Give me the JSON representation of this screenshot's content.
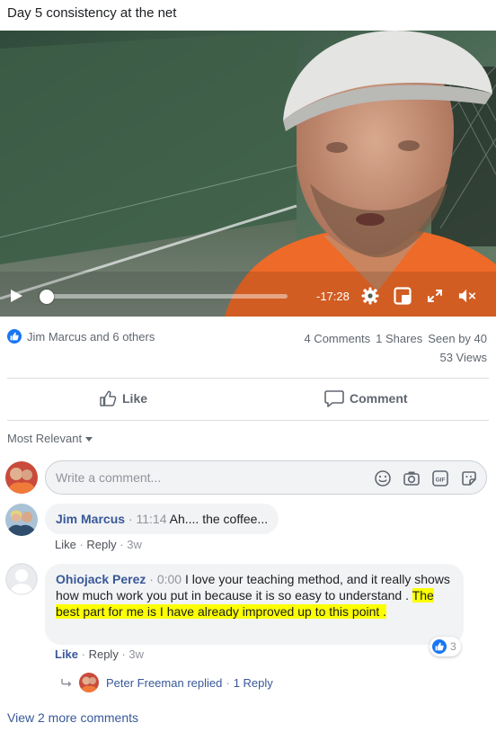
{
  "post": {
    "title": "Day 5 consistency at the net"
  },
  "video": {
    "time_remaining": "-17:28",
    "progress_fraction": 0.0,
    "controls": [
      "play-icon",
      "gear-icon",
      "pip-icon",
      "fullscreen-icon",
      "mute-icon"
    ]
  },
  "stats": {
    "reactions_text": "Jim Marcus and 6 others",
    "comments": "4 Comments",
    "shares": "1 Shares",
    "seen_by": "Seen by 40",
    "views": "53 Views"
  },
  "actions": {
    "like_label": "Like",
    "comment_label": "Comment"
  },
  "sort": {
    "label": "Most Relevant"
  },
  "composer": {
    "placeholder": "Write a comment...",
    "value": ""
  },
  "comments": [
    {
      "author": "Jim Marcus",
      "time": "11:14",
      "text": "Ah.... the coffee...",
      "like_label": "Like",
      "reply_label": "Reply",
      "age": "3w"
    },
    {
      "author": "Ohiojack Perez",
      "time": "0:00",
      "text_plain": "I love your teaching method, and it really shows how much work you put in because it is so easy to understand .",
      "text_highlight": "The best part for me is I have already improved up to this point .",
      "like_label": "Like",
      "reply_label": "Reply",
      "age": "3w",
      "reaction_count": "3",
      "replies": {
        "replier": "Peter Freeman replied",
        "count": "1 Reply"
      }
    }
  ],
  "view_more": "View 2 more comments",
  "colors": {
    "link": "#385898",
    "brand_blue": "#1877f2",
    "highlight": "#fcff00"
  }
}
